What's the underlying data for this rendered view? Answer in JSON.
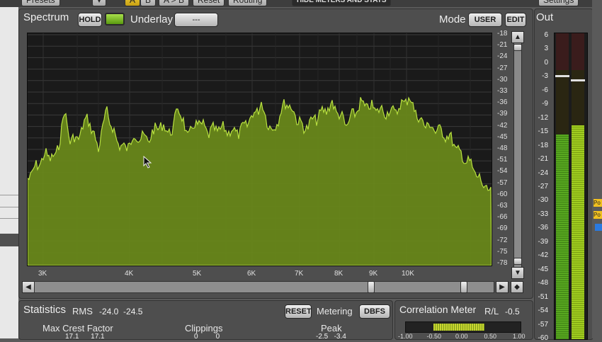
{
  "topbar": {
    "presets": "Presets",
    "a": "A",
    "b": "B",
    "atob": "A > B",
    "reset": "Reset",
    "routing": "Routing",
    "hide_meters": "HIDE METERS AND STATS",
    "settings": "Settings"
  },
  "spectrum": {
    "title": "Spectrum",
    "hold_label": "HOLD",
    "underlay_label": "Underlay",
    "underlay_value": "---",
    "mode_label": "Mode",
    "mode_value": "USER",
    "edit_label": "EDIT",
    "y_ticks": [
      "-18",
      "-21",
      "-24",
      "-27",
      "-30",
      "-33",
      "-36",
      "-39",
      "-42",
      "-45",
      "-48",
      "-51",
      "-54",
      "-57",
      "-60",
      "-63",
      "-66",
      "-69",
      "-72",
      "-75",
      "-78"
    ],
    "x_ticks": [
      "3K",
      "4K",
      "5K",
      "6K",
      "7K",
      "8K",
      "9K",
      "10K"
    ]
  },
  "out": {
    "title": "Out",
    "scale": [
      "6",
      "3",
      "0",
      "-3",
      "-6",
      "-9",
      "-12",
      "-15",
      "-18",
      "-21",
      "-24",
      "-27",
      "-30",
      "-33",
      "-36",
      "-39",
      "-42",
      "-45",
      "-48",
      "-51",
      "-54",
      "-57",
      "-60"
    ],
    "left_level_db": -15.5,
    "right_level_db": -13.5,
    "left_peak_db": -2.5,
    "right_peak_db": -3.4
  },
  "statistics": {
    "title": "Statistics",
    "rms_label": "RMS",
    "rms_values": "-24.0  -24.5",
    "reset_label": "RESET",
    "metering_label": "Metering",
    "metering_value": "DBFS",
    "max_crest_label": "Max Crest Factor",
    "max_crest_values": "17.1      17.1",
    "clippings_label": "Clippings",
    "clippings_values": "0         0",
    "peak_label": "Peak",
    "peak_values": "-2.5   -3.4"
  },
  "correlation": {
    "title": "Correlation Meter",
    "rl_label": "R/L",
    "rl_value": "-0.5",
    "ticks": [
      "-1.00",
      "-0.50",
      "0.00",
      "0.50",
      "1.00"
    ],
    "value": -0.5
  },
  "colors": {
    "spectrum_fill": "#6a8a1a",
    "spectrum_line": "#b8e040",
    "meter_green": "#58a820",
    "accent_yellow": "#f0c020"
  }
}
